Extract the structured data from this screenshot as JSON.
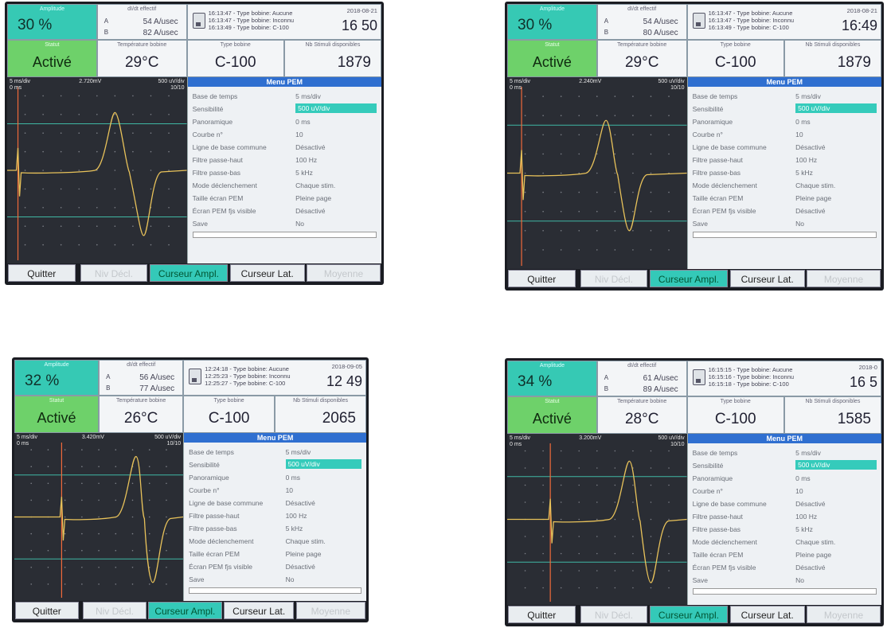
{
  "labels": {
    "amplitude": "Amplitude",
    "dvdt": "dI/dt effectif",
    "statut": "Statut",
    "temperature": "Température bobine",
    "type": "Type bobine",
    "stimuli": "Nb Stimuli disponibles",
    "menu_title": "Menu PEM",
    "dvdt_a": "A",
    "dvdt_b": "B",
    "osc_tl": "5 ms/div\n0 ms",
    "osc_tr": "500 uV/div\n10/10"
  },
  "menu_rows": [
    {
      "k": "Base de temps",
      "v": "5 ms/div"
    },
    {
      "k": "Sensibilité",
      "v": "500 uV/div"
    },
    {
      "k": "Panoramique",
      "v": "0 ms"
    },
    {
      "k": "Courbe n°",
      "v": "10"
    },
    {
      "k": "Ligne de base commune",
      "v": "Désactivé"
    },
    {
      "k": "Filtre passe-haut",
      "v": "100 Hz"
    },
    {
      "k": "Filtre passe-bas",
      "v": "5 kHz"
    },
    {
      "k": "Mode déclenchement",
      "v": "Chaque stim."
    },
    {
      "k": "Taille écran PEM",
      "v": "Pleine page"
    },
    {
      "k": "Écran PEM fjs visible",
      "v": "Désactivé"
    },
    {
      "k": "Save",
      "v": "No"
    }
  ],
  "buttons": [
    "Quitter",
    "Niv Décl.",
    "Curseur Ampl.",
    "Curseur Lat.",
    "Moyenne"
  ],
  "panels": [
    {
      "amplitude": "30 %",
      "dvdt_a": "54 A/usec",
      "dvdt_b": "82 A/usec",
      "log": [
        "16:13:47 - Type bobine: Aucune",
        "16:13:47 - Type bobine: Inconnu",
        "16:13:49 - Type bobine: C-100"
      ],
      "date": "2018-08-21",
      "time": "16 50",
      "statut": "Activé",
      "temp": "29°C",
      "type": "C-100",
      "stimuli": "1879",
      "osc_mid": "2.720mV"
    },
    {
      "amplitude": "30 %",
      "dvdt_a": "54 A/usec",
      "dvdt_b": "80 A/usec",
      "log": [
        "16:13:47 - Type bobine: Aucune",
        "16:13:47 - Type bobine: Inconnu",
        "16:13:49 - Type bobine: C-100"
      ],
      "date": "2018-08-21",
      "time": "16:49",
      "statut": "Activé",
      "temp": "29°C",
      "type": "C-100",
      "stimuli": "1879",
      "osc_mid": "2.240mV"
    },
    {
      "amplitude": "32 %",
      "dvdt_a": "56 A/usec",
      "dvdt_b": "77 A/usec",
      "log": [
        "12:24:18 - Type bobine: Aucune",
        "12:25:23 - Type bobine: Inconnu",
        "12:25:27 - Type bobine: C-100"
      ],
      "date": "2018-09-05",
      "time": "12 49",
      "statut": "Activé",
      "temp": "26°C",
      "type": "C-100",
      "stimuli": "2065",
      "osc_mid": "3.420mV"
    },
    {
      "amplitude": "34 %",
      "dvdt_a": "61 A/usec",
      "dvdt_b": "89 A/usec",
      "log": [
        "16:15:15 - Type bobine: Aucune",
        "16:15:16 - Type bobine: Inconnu",
        "16:15:18 - Type bobine: C-100"
      ],
      "date": "2018-0",
      "time": "16 5",
      "statut": "Activé",
      "temp": "28°C",
      "type": "C-100",
      "stimuli": "1585",
      "osc_mid": "3.200mV"
    }
  ],
  "colors": {
    "trace": "#e8c25a",
    "cursor": "#f06a3a",
    "hline": "#3fb7a3",
    "grid": "#7d8088"
  }
}
